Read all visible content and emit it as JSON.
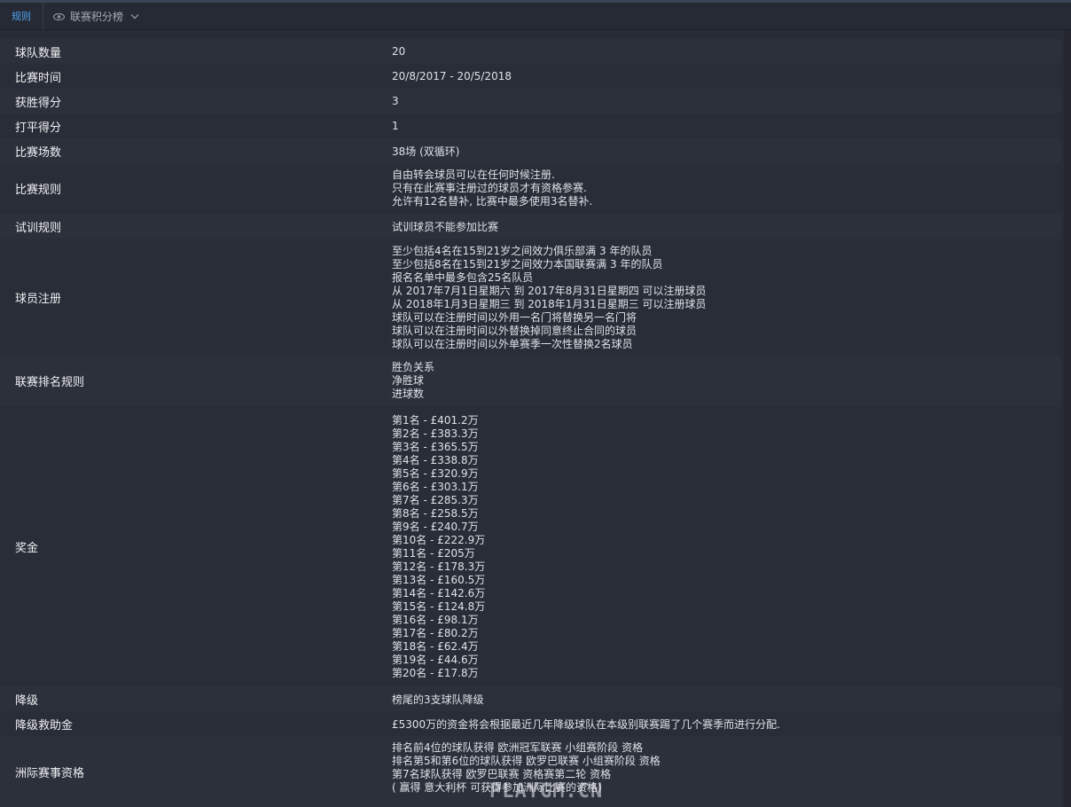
{
  "toolbar": {
    "tab_label": "规则",
    "view_label": "联赛积分榜"
  },
  "rules": {
    "teams_label": "球队数量",
    "teams_value": "20",
    "dates_label": "比赛时间",
    "dates_value": "20/8/2017 - 20/5/2018",
    "win_label": "获胜得分",
    "win_value": "3",
    "draw_label": "打平得分",
    "draw_value": "1",
    "matches_label": "比赛场数",
    "matches_value": "38场 (双循环)",
    "match_rules_label": "比赛规则",
    "match_rules": [
      "自由转会球员可以在任何时候注册.",
      "只有在此赛事注册过的球员才有资格参赛.",
      "允许有12名替补, 比赛中最多使用3名替补."
    ],
    "trial_label": "试训规则",
    "trial_value": "试训球员不能参加比赛",
    "registration_label": "球员注册",
    "registration": [
      "至少包括4名在15到21岁之间效力俱乐部满 3 年的队员",
      "至少包括8名在15到21岁之间效力本国联赛满 3 年的队员",
      "报名名单中最多包含25名队员",
      "从 2017年7月1日星期六 到 2017年8月31日星期四 可以注册球员",
      "从 2018年1月3日星期三 到 2018年1月31日星期三 可以注册球员",
      "球队可以在注册时间以外用一名门将替换另一名门将",
      "球队可以在注册时间以外替换掉同意终止合同的球员",
      "球队可以在注册时间以外单赛季一次性替换2名球员"
    ],
    "ranking_label": "联赛排名规则",
    "ranking": [
      "胜负关系",
      "净胜球",
      "进球数"
    ],
    "prize_label": "奖金",
    "prizes": [
      "第1名 - £401.2万",
      "第2名 - £383.3万",
      "第3名 - £365.5万",
      "第4名 - £338.8万",
      "第5名 - £320.9万",
      "第6名 - £303.1万",
      "第7名 - £285.3万",
      "第8名 - £258.5万",
      "第9名 - £240.7万",
      "第10名 - £222.9万",
      "第11名 - £205万",
      "第12名 - £178.3万",
      "第13名 - £160.5万",
      "第14名 - £142.6万",
      "第15名 - £124.8万",
      "第16名 - £98.1万",
      "第17名 - £80.2万",
      "第18名 - £62.4万",
      "第19名 - £44.6万",
      "第20名 - £17.8万"
    ],
    "relegation_label": "降级",
    "relegation_value": "榜尾的3支球队降级",
    "parachute_label": "降级救助金",
    "parachute_value": "£5300万的资金将会根据最近几年降级球队在本级别联赛踢了几个赛季而进行分配.",
    "continental_label": "洲际赛事资格",
    "continental": [
      "排名前4位的球队获得 欧洲冠军联赛 小组赛阶段 资格",
      "排名第5和第6位的球队获得 欧罗巴联赛 小组赛阶段 资格",
      "第7名球队获得 欧罗巴联赛 资格赛第二轮 资格",
      "( 赢得 意大利杯 可获得参加洲际比赛的资格)"
    ]
  },
  "watermark": "PLAYGM.CN",
  "icons": {
    "view": "eye-icon",
    "dropdown": "chevron-down-icon"
  }
}
